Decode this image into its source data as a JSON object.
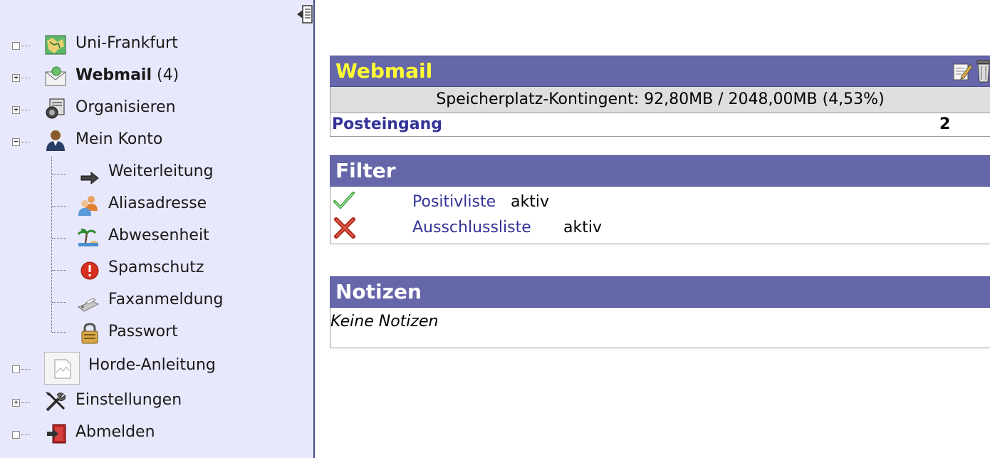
{
  "sidebar": {
    "items": [
      {
        "label": "Uni-Frankfurt",
        "toggle": "",
        "icon": "map-icon"
      },
      {
        "label": "Webmail",
        "count": "(4)",
        "toggle": "+",
        "icon": "mail-icon"
      },
      {
        "label": "Organisieren",
        "toggle": "+",
        "icon": "organizer-icon"
      },
      {
        "label": "Mein Konto",
        "toggle": "−",
        "icon": "user-icon"
      },
      {
        "label": "Horde-Anleitung",
        "toggle": "",
        "icon": "document-icon"
      },
      {
        "label": "Einstellungen",
        "toggle": "+",
        "icon": "tools-icon"
      },
      {
        "label": "Abmelden",
        "toggle": "",
        "icon": "logout-icon"
      }
    ],
    "children": [
      {
        "label": "Weiterleitung",
        "icon": "arrow-right-icon"
      },
      {
        "label": "Aliasadresse",
        "icon": "users-icon"
      },
      {
        "label": "Abwesenheit",
        "icon": "beach-icon"
      },
      {
        "label": "Spamschutz",
        "icon": "stop-icon"
      },
      {
        "label": "Faxanmeldung",
        "icon": "fax-icon"
      },
      {
        "label": "Passwort",
        "icon": "lock-icon"
      }
    ]
  },
  "webmail": {
    "title": "Webmail",
    "quota": "Speicherplatz-Kontingent: 92,80MB / 2048,00MB (4,53%)",
    "inbox_label": "Posteingang",
    "inbox_count": "2"
  },
  "filter": {
    "title": "Filter",
    "rows": [
      {
        "link": "Positivliste",
        "state": "aktiv",
        "icon": "check-icon"
      },
      {
        "link": "Ausschlussliste",
        "state": "aktiv",
        "icon": "cross-icon"
      }
    ]
  },
  "notes": {
    "title": "Notizen",
    "empty_text": "Keine Notizen"
  },
  "colors": {
    "header_bg": "#6666aa",
    "sidebar_bg": "#e8e8fc",
    "link": "#333399",
    "title_yellow": "#ffff33"
  }
}
